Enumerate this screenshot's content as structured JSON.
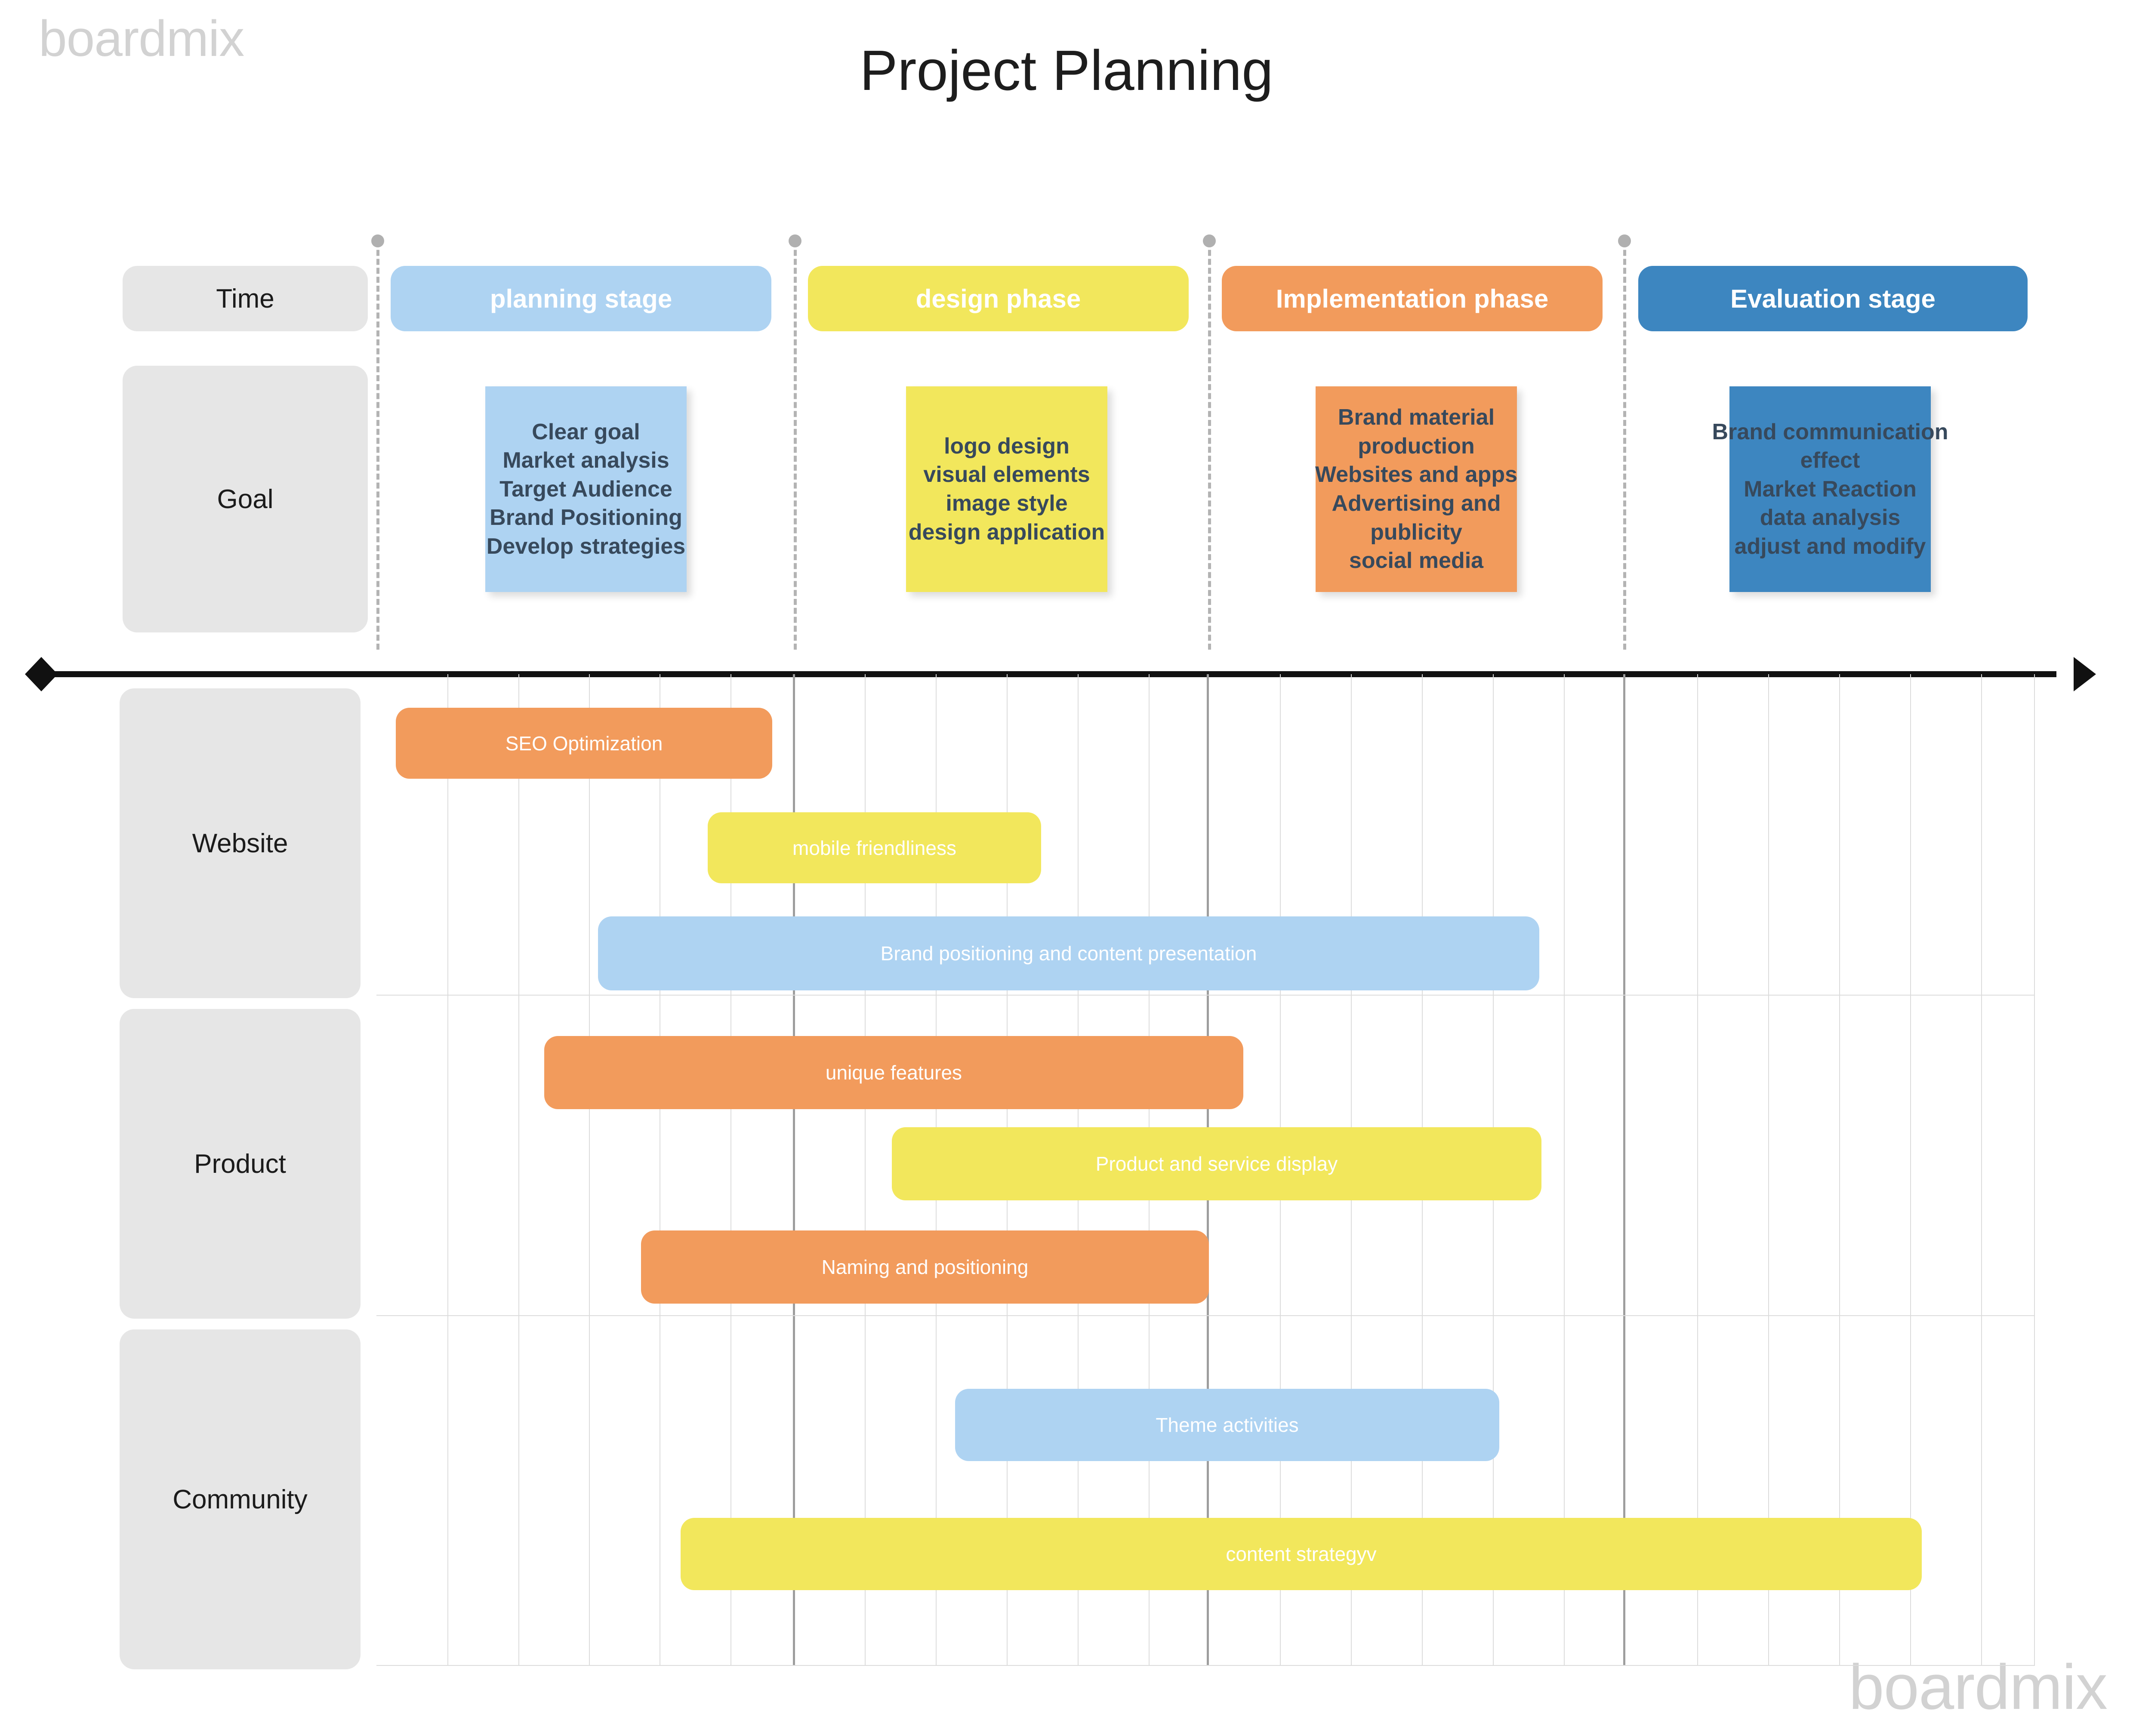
{
  "watermark": {
    "top": "boardmix",
    "bottom": "boardmix"
  },
  "header": {
    "title": "Project Planning"
  },
  "row_labels": {
    "time": "Time",
    "goal": "Goal",
    "website": "Website",
    "product": "Product",
    "community": "Community"
  },
  "colors": {
    "blue_light": "#aed3f2",
    "yellow": "#f2e75c",
    "orange": "#f29b5c",
    "blue_dark": "#3d86c0",
    "chip_grey": "#e6e6e6",
    "sticky_text": "#37495c",
    "grid_minor": "#dcdcdc",
    "grid_major": "#9e9e9e",
    "axis": "#111111",
    "watermark": "#d2d2d2"
  },
  "stages": [
    {
      "label": "planning stage",
      "color": "#aed3f2"
    },
    {
      "label": "design phase",
      "color": "#f2e75c"
    },
    {
      "label": "Implementation phase",
      "color": "#f29b5c"
    },
    {
      "label": "Evaluation stage",
      "color": "#3d86c0"
    }
  ],
  "goal_notes": [
    {
      "color": "#aed3f2",
      "lines": [
        "Clear goal",
        "Market analysis",
        "Target Audience",
        "Brand Positioning",
        "Develop strategies"
      ]
    },
    {
      "color": "#f2e75c",
      "lines": [
        "logo design",
        "visual elements",
        "image style",
        "design application"
      ]
    },
    {
      "color": "#f29b5c",
      "lines": [
        "Brand material",
        "production",
        "Websites and apps",
        "Advertising and",
        "publicity",
        "social media"
      ]
    },
    {
      "color": "#3d86c0",
      "lines": [
        "Brand communication",
        "effect",
        "Market Reaction",
        "data analysis",
        "adjust and modify"
      ]
    }
  ],
  "chart_data": {
    "type": "bar",
    "title": "Project Planning",
    "subtitle": "",
    "xlabel": "",
    "ylabel": "",
    "orientation": "horizontal-gantt",
    "grid": true,
    "legend_position": "none",
    "phase_boundaries": [
      "planning stage",
      "design phase",
      "Implementation phase",
      "Evaluation stage"
    ],
    "categories": [
      "Website",
      "Product",
      "Community"
    ],
    "series": [
      {
        "name": "Website",
        "tasks": [
          {
            "label": "SEO Optimization",
            "color": "#f29b5c",
            "start": 0.0,
            "end": 0.07
          },
          {
            "label": "mobile friendliness",
            "color": "#f2e75c",
            "start": 0.06,
            "end": 0.13
          },
          {
            "label": "Brand positioning and content presentation",
            "color": "#aed3f2",
            "start": 0.04,
            "end": 0.22
          }
        ]
      },
      {
        "name": "Product",
        "tasks": [
          {
            "label": "unique features",
            "color": "#f29b5c",
            "start": 0.03,
            "end": 0.17
          },
          {
            "label": "Product and service display",
            "color": "#f2e75c",
            "start": 0.09,
            "end": 0.22
          },
          {
            "label": "Naming and positioning",
            "color": "#f29b5c",
            "start": 0.05,
            "end": 0.16
          }
        ]
      },
      {
        "name": "Community",
        "tasks": [
          {
            "label": "Theme activities",
            "color": "#aed3f2",
            "start": 0.11,
            "end": 0.21
          },
          {
            "label": "content strategyv",
            "color": "#f2e75c",
            "start": 0.06,
            "end": 0.28
          }
        ]
      }
    ]
  }
}
